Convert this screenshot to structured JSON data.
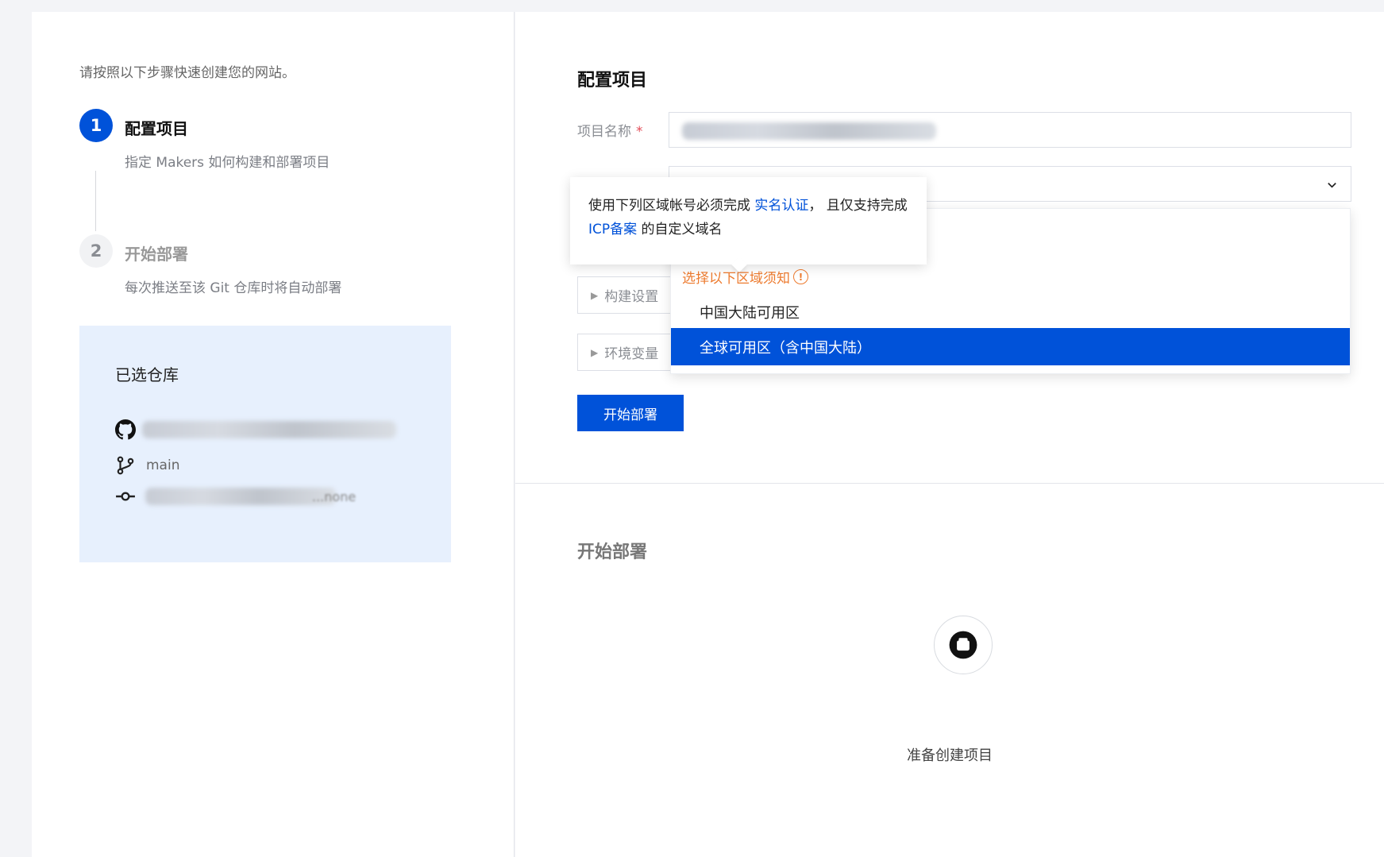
{
  "left": {
    "intro": "请按照以下步骤快速创建您的网站。",
    "steps": [
      {
        "number": "1",
        "title": "配置项目",
        "desc": "指定 Makers 如何构建和部署项目"
      },
      {
        "number": "2",
        "title": "开始部署",
        "desc": "每次推送至该 Git 仓库时将自动部署"
      }
    ],
    "repo": {
      "title": "已选仓库",
      "branch": "main",
      "commit_suffix": "...none"
    }
  },
  "right": {
    "config_title": "配置项目",
    "project_name_label": "项目名称",
    "required_mark": "*",
    "build_settings": "构建设置",
    "env_vars": "环境变量",
    "deploy_button": "开始部署",
    "deploy_title": "开始部署",
    "deploy_status": "准备创建项目"
  },
  "tooltip": {
    "text1": "使用下列区域帐号必须完成 ",
    "link1": "实名认证",
    "text2": "，  且仅支持完成 ",
    "link2": "ICP备案",
    "text3": " 的自定义域名"
  },
  "dropdown": {
    "warning": "选择以下区域须知",
    "options": [
      {
        "label": "中国大陆可用区",
        "selected": false
      },
      {
        "label": "全球可用区（含中国大陆）",
        "selected": true
      }
    ]
  },
  "colors": {
    "primary": "#0052d9",
    "warning": "#ed7b2f",
    "card_bg": "#e7f0fd"
  }
}
